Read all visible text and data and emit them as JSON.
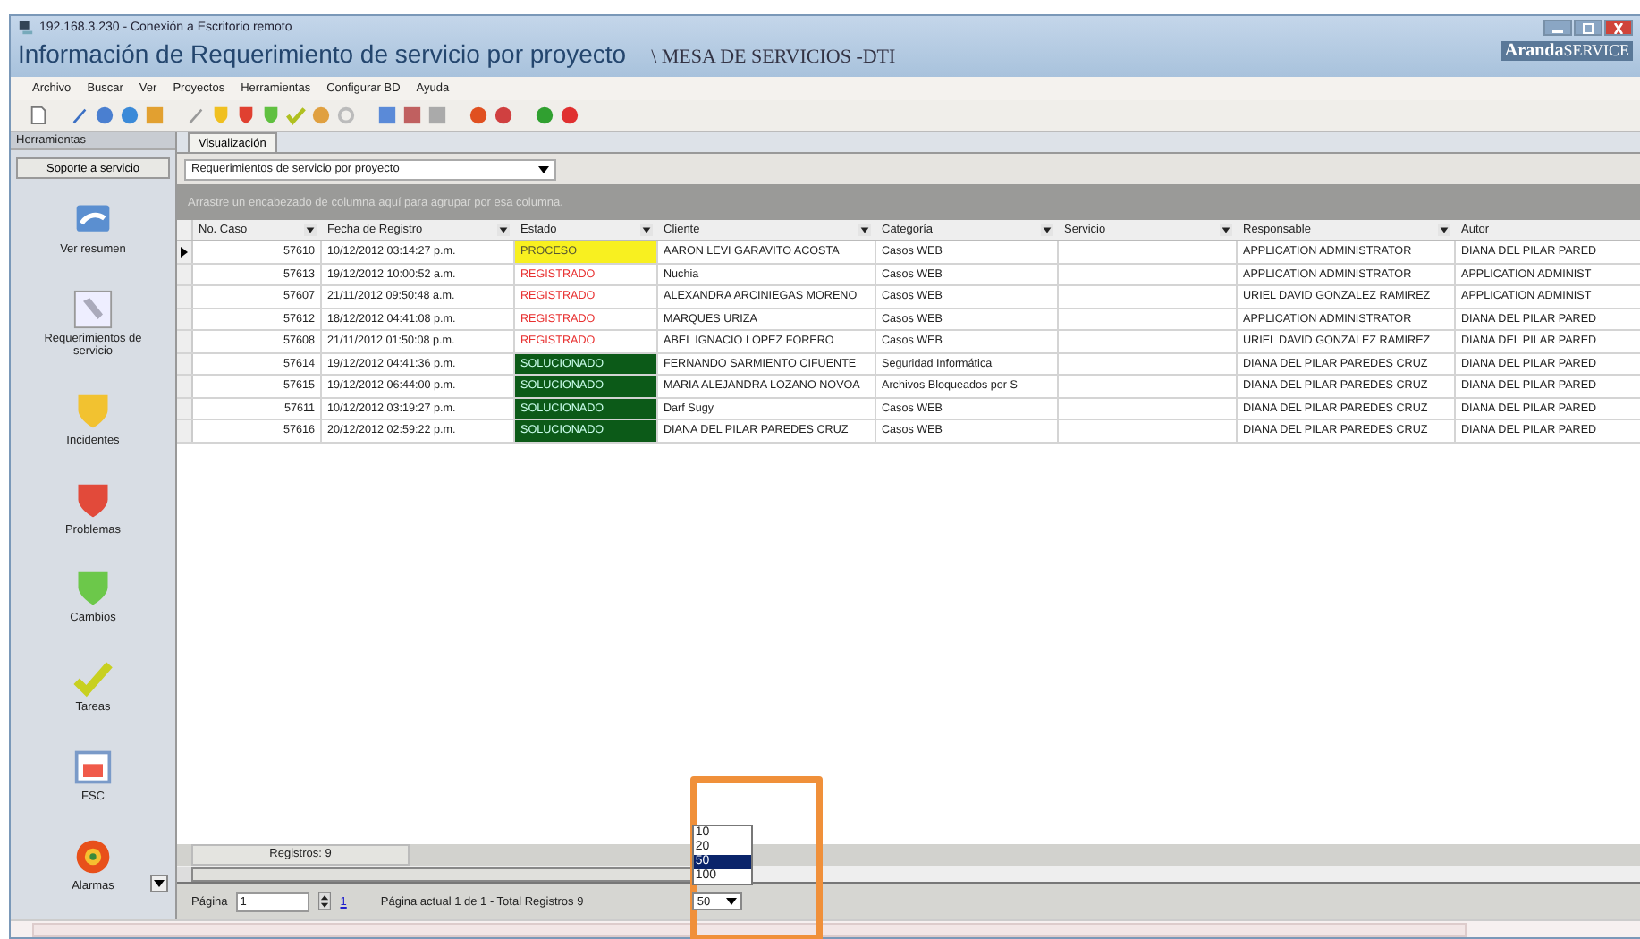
{
  "window": {
    "connection_title": "192.168.3.230 - Conexión a Escritorio remoto",
    "title": "Información de Requerimiento de servicio por proyecto",
    "subtitle": "\\ MESA DE SERVICIOS -DTI",
    "brand": "Aranda",
    "brand_suffix": "SERVICE"
  },
  "menu": [
    "Archivo",
    "Buscar",
    "Ver",
    "Proyectos",
    "Herramientas",
    "Configurar BD",
    "Ayuda"
  ],
  "sidebar": {
    "header": "Herramientas",
    "section": "Soporte a servicio",
    "items": [
      {
        "label": "Ver resumen",
        "kind": "summary"
      },
      {
        "label": "Requerimientos de servicio",
        "kind": "request"
      },
      {
        "label": "Incidentes",
        "kind": "incident"
      },
      {
        "label": "Problemas",
        "kind": "problem"
      },
      {
        "label": "Cambios",
        "kind": "change"
      },
      {
        "label": "Tareas",
        "kind": "task"
      },
      {
        "label": "FSC",
        "kind": "calendar"
      },
      {
        "label": "Alarmas",
        "kind": "alarm"
      }
    ]
  },
  "tabs": [
    {
      "label": "Visualización",
      "selected": true
    }
  ],
  "view_select": {
    "value": "Requerimientos de servicio por proyecto"
  },
  "group_hint": "Arrastre un encabezado de columna aquí para agrupar por esa columna.",
  "table": {
    "columns": [
      "No. Caso",
      "Fecha de Registro",
      "Estado",
      "Cliente",
      "Categoría",
      "Servicio",
      "Responsable",
      "Autor"
    ],
    "rows": [
      {
        "current": true,
        "caso": "57610",
        "fecha": "10/12/2012 03:14:27 p.m.",
        "estado": {
          "label": "PROCESO",
          "kind": "process"
        },
        "cliente": "AARON LEVI GARAVITO ACOSTA",
        "categoria": "Casos WEB",
        "responsable": "APPLICATION ADMINISTRATOR",
        "autor": "DIANA DEL PILAR PARED"
      },
      {
        "current": false,
        "caso": "57613",
        "fecha": "19/12/2012 10:00:52 a.m.",
        "estado": {
          "label": "REGISTRADO",
          "kind": "registered"
        },
        "cliente": "Nuchia",
        "categoria": "Casos WEB",
        "responsable": "APPLICATION ADMINISTRATOR",
        "autor": "APPLICATION ADMINIST"
      },
      {
        "current": false,
        "caso": "57607",
        "fecha": "21/11/2012 09:50:48 a.m.",
        "estado": {
          "label": "REGISTRADO",
          "kind": "registered"
        },
        "cliente": "ALEXANDRA ARCINIEGAS MORENO",
        "categoria": "Casos WEB",
        "responsable": "URIEL DAVID GONZALEZ RAMIREZ",
        "autor": "APPLICATION ADMINIST"
      },
      {
        "current": false,
        "caso": "57612",
        "fecha": "18/12/2012 04:41:08 p.m.",
        "estado": {
          "label": "REGISTRADO",
          "kind": "registered"
        },
        "cliente": "MARQUES URIZA",
        "categoria": "Casos WEB",
        "responsable": "APPLICATION ADMINISTRATOR",
        "autor": "DIANA DEL PILAR PARED"
      },
      {
        "current": false,
        "caso": "57608",
        "fecha": "21/11/2012 01:50:08 p.m.",
        "estado": {
          "label": "REGISTRADO",
          "kind": "registered"
        },
        "cliente": "ABEL IGNACIO LOPEZ FORERO",
        "categoria": "Casos WEB",
        "responsable": "URIEL DAVID GONZALEZ RAMIREZ",
        "autor": "DIANA DEL PILAR PARED"
      },
      {
        "current": false,
        "caso": "57614",
        "fecha": "19/12/2012 04:41:36 p.m.",
        "estado": {
          "label": "SOLUCIONADO",
          "kind": "solved"
        },
        "cliente": "FERNANDO SARMIENTO CIFUENTE",
        "categoria": "Seguridad Informática",
        "responsable": "DIANA DEL PILAR PAREDES CRUZ",
        "autor": "DIANA DEL PILAR PARED"
      },
      {
        "current": false,
        "caso": "57615",
        "fecha": "19/12/2012 06:44:00 p.m.",
        "estado": {
          "label": "SOLUCIONADO",
          "kind": "solved"
        },
        "cliente": "MARIA ALEJANDRA LOZANO NOVOA",
        "categoria": "Archivos Bloqueados por S",
        "responsable": "DIANA DEL PILAR PAREDES CRUZ",
        "autor": "DIANA DEL PILAR PARED"
      },
      {
        "current": false,
        "caso": "57611",
        "fecha": "10/12/2012 03:19:27 p.m.",
        "estado": {
          "label": "SOLUCIONADO",
          "kind": "solved"
        },
        "cliente": "Darf Sugy",
        "categoria": "Casos WEB",
        "responsable": "DIANA DEL PILAR PAREDES CRUZ",
        "autor": "DIANA DEL PILAR PARED"
      },
      {
        "current": false,
        "caso": "57616",
        "fecha": "20/12/2012 02:59:22 p.m.",
        "estado": {
          "label": "SOLUCIONADO",
          "kind": "solved"
        },
        "cliente": "DIANA DEL PILAR PAREDES CRUZ",
        "categoria": "Casos WEB",
        "responsable": "DIANA DEL PILAR PAREDES CRUZ",
        "autor": "DIANA DEL PILAR PARED"
      }
    ]
  },
  "footer": {
    "count": "Registros: 9"
  },
  "pager": {
    "label": "Página",
    "page": "1",
    "link": "1",
    "summary": "Página actual 1 de 1 - Total Registros 9",
    "page_size": "50",
    "page_size_options": [
      {
        "label": "10",
        "selected": false
      },
      {
        "label": "20",
        "selected": false
      },
      {
        "label": "50",
        "selected": true
      },
      {
        "label": "100",
        "selected": false
      }
    ]
  }
}
